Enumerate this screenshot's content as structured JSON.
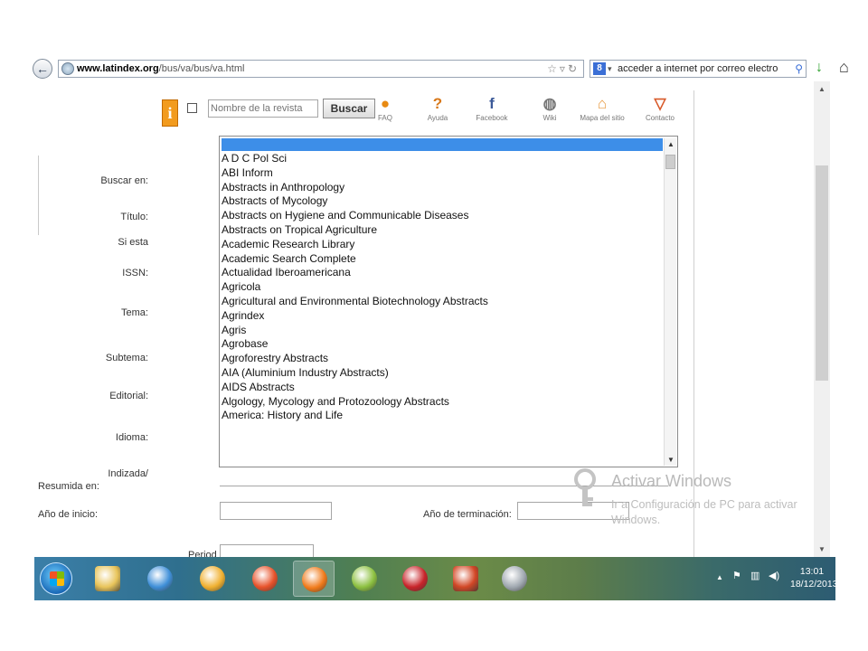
{
  "browser": {
    "url_domain": "www.latindex.org",
    "url_path": "/bus/va/bus/va.html",
    "search_text": "acceder a internet por correo electro"
  },
  "site_nav": [
    {
      "label": "FAQ",
      "glyph": "●",
      "color": "#e88a12"
    },
    {
      "label": "Ayuda",
      "glyph": "?",
      "color": "#d8781a"
    },
    {
      "label": "Facebook",
      "glyph": "f",
      "color": "#3b5998"
    },
    {
      "label": "Wiki",
      "glyph": "◍",
      "color": "#777777"
    },
    {
      "label": "Mapa del sitio",
      "glyph": "⌂",
      "color": "#e89a40"
    },
    {
      "label": "Contacto",
      "glyph": "▽",
      "color": "#d85a2a"
    }
  ],
  "search": {
    "placeholder": "Nombre de la revista",
    "button_label": "Buscar"
  },
  "form_labels": {
    "buscar_en": "Buscar en:",
    "titulo": "Título:",
    "si_esta": "Si esta",
    "issn": "ISSN:",
    "tema": "Tema:",
    "subtema": "Subtema:",
    "editorial": "Editorial:",
    "idioma": "Idioma:",
    "indizada": "Indizada/",
    "resumida": "Resumida en:",
    "anio_inicio": "Año de inicio:",
    "anio_termino": "Año de terminación:",
    "periodo": "Period"
  },
  "dropdown_items": [
    "A D C Pol Sci",
    "ABI Inform",
    "Abstracts in Anthropology",
    "Abstracts of Mycology",
    "Abstracts on Hygiene and Communicable Diseases",
    "Abstracts on Tropical Agriculture",
    "Academic Research Library",
    "Academic Search Complete",
    "Actualidad Iberoamericana",
    "Agricola",
    "Agricultural and Environmental Biotechnology Abstracts",
    "Agrindex",
    "Agris",
    "Agrobase",
    "Agroforestry Abstracts",
    "AIA (Aluminium Industry Abstracts)",
    "AIDS Abstracts",
    "Algology, Mycology and Protozoology Abstracts",
    "America: History and Life"
  ],
  "watermark": {
    "title": "Activar Windows",
    "subtitle": "Ir a Configuración de PC para activar Windows."
  },
  "clock": {
    "time": "13:01",
    "date": "18/12/2013"
  },
  "taskbar_apps": [
    {
      "name": "explorer",
      "color": "#e8c45a"
    },
    {
      "name": "internet-explorer",
      "color": "#3f8fd8"
    },
    {
      "name": "paint",
      "color": "#f0b030"
    },
    {
      "name": "chrome",
      "color": "#e8522a"
    },
    {
      "name": "firefox",
      "color": "#f07a1a"
    },
    {
      "name": "app-5",
      "color": "#8cc040"
    },
    {
      "name": "app-6",
      "color": "#c8242a"
    },
    {
      "name": "powerpoint",
      "color": "#d24726"
    },
    {
      "name": "app-8",
      "color": "#a0a8b0"
    }
  ]
}
